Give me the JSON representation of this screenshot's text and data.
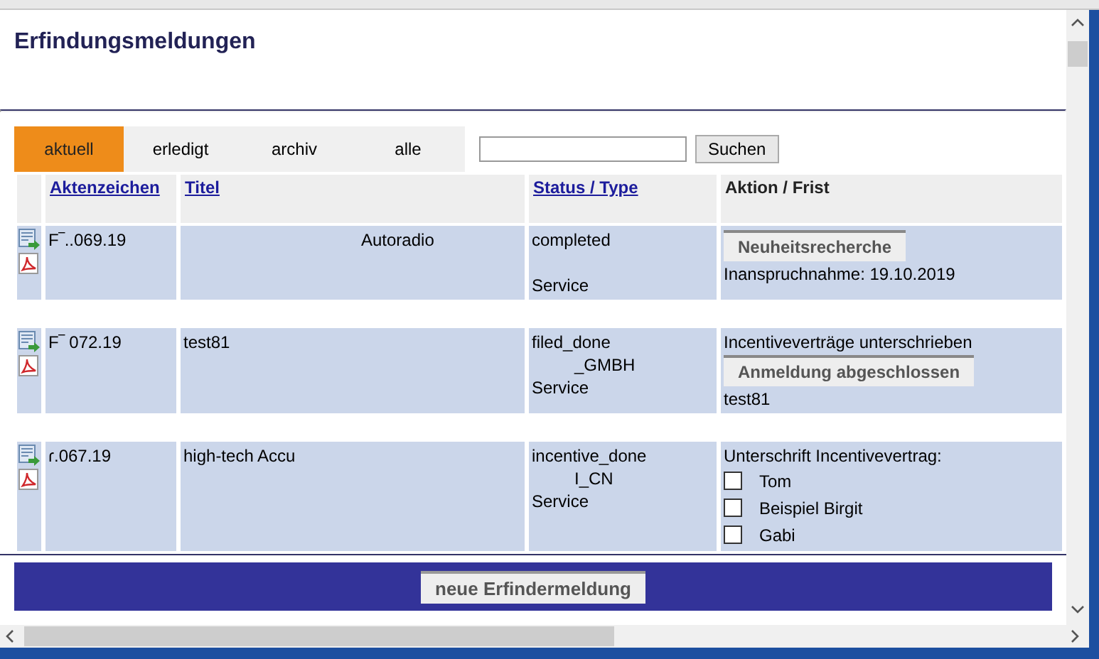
{
  "title": "Erfindungsmeldungen",
  "tabs": [
    {
      "label": "aktuell",
      "selected": true
    },
    {
      "label": "erledigt",
      "selected": false
    },
    {
      "label": "archiv",
      "selected": false
    },
    {
      "label": "alle",
      "selected": false
    }
  ],
  "search": {
    "button": "Suchen"
  },
  "table": {
    "columns": [
      {
        "label": "Aktenzeichen",
        "kind": "link"
      },
      {
        "label": "Titel",
        "kind": "link"
      },
      {
        "label": "Status / Type",
        "kind": "link"
      },
      {
        "label": "Aktion / Frist",
        "kind": "plain"
      }
    ],
    "rows": [
      {
        "file_no": "F‾..069.19",
        "title": "Autoradio",
        "title_indent": true,
        "status": "completed",
        "type": "Service",
        "actions": [
          {
            "kind": "button",
            "text": "Neuheitsrecherche"
          },
          {
            "kind": "text",
            "text": "Inanspruchnahme: 19.10.2019"
          }
        ]
      },
      {
        "file_no": "F‾ 072.19",
        "title": "test81",
        "title_indent": false,
        "status": "filed_done",
        "owner": "_GMBH",
        "type": "Service",
        "actions": [
          {
            "kind": "text",
            "text": "Incentiveverträge unterschrieben"
          },
          {
            "kind": "button",
            "text": "Anmeldung abgeschlossen"
          },
          {
            "kind": "text",
            "text": "test81"
          }
        ]
      },
      {
        "file_no": "ɾ.067.19",
        "title": "high-tech Accu",
        "title_indent": false,
        "status": "incentive_done",
        "owner": "I_CN",
        "type": "Service",
        "actions": [
          {
            "kind": "text",
            "text": "Unterschrift Incentivevertrag:"
          },
          {
            "kind": "check",
            "text": "Tom",
            "checked": false
          },
          {
            "kind": "check",
            "text": "Beispiel Birgit",
            "checked": false
          },
          {
            "kind": "check",
            "text": "Gabi",
            "checked": false
          }
        ]
      }
    ]
  },
  "footer": {
    "button": "neue Erfindermeldung"
  }
}
